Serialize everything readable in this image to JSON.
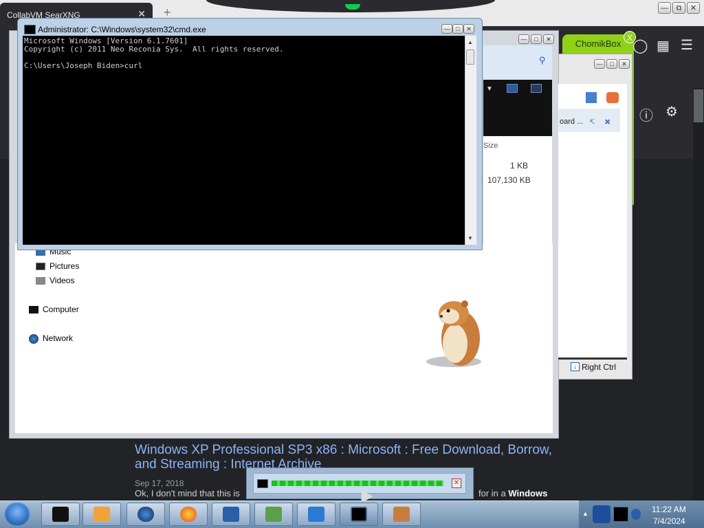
{
  "browser": {
    "tab_title": "CollabVM SearXNG",
    "tab_close": "✕",
    "new_tab": "+",
    "chomik_tab": "ChomikBox",
    "chomik_close": "X"
  },
  "explorer": {
    "column_size": "Size",
    "file_sizes": [
      "1 KB",
      "107,130 KB"
    ],
    "nav_items": [
      {
        "label": "Music"
      },
      {
        "label": "Pictures"
      },
      {
        "label": "Videos"
      },
      {
        "label": "Computer"
      },
      {
        "label": "Network"
      }
    ]
  },
  "vbox": {
    "row_label": "oard ...",
    "host_key": "Right Ctrl"
  },
  "cmd": {
    "title": "Administrator: C:\\Windows\\system32\\cmd.exe",
    "lines": "Microsoft Windows [Version 6.1.7601]\nCopyright (c) 2011 Neo Reconia Sys.  All rights reserved.\n\nC:\\Users\\Joseph Biden>curl"
  },
  "search_result": {
    "title": "Windows XP Professional SP3 x86 : Microsoft : Free Download, Borrow, and Streaming : Internet Archive",
    "date": "Sep 17, 2018",
    "snippet": "Ok, I don't mind that this is",
    "snippet_tail_prefix": "for in a",
    "snippet_tail_bold": "Windows"
  },
  "tooltip": {
    "close": "✕",
    "progress": 1.0
  },
  "taskbar": {
    "time": "11:22 AM",
    "date": "7/4/2024",
    "apps": [
      {
        "icon": "vm-black-box-icon"
      },
      {
        "icon": "media-player-icon"
      },
      {
        "icon": "globe-icon"
      },
      {
        "icon": "firefox-icon"
      },
      {
        "icon": "virtualbox-icon"
      },
      {
        "icon": "users-icon"
      },
      {
        "icon": "windows-xp-icon"
      },
      {
        "icon": "cmd-icon"
      },
      {
        "icon": "hamster-app-icon"
      }
    ]
  },
  "colors": {
    "cmd_bg": "#000000",
    "accent_green": "#8fd018",
    "link_blue": "#8ab4f8"
  }
}
